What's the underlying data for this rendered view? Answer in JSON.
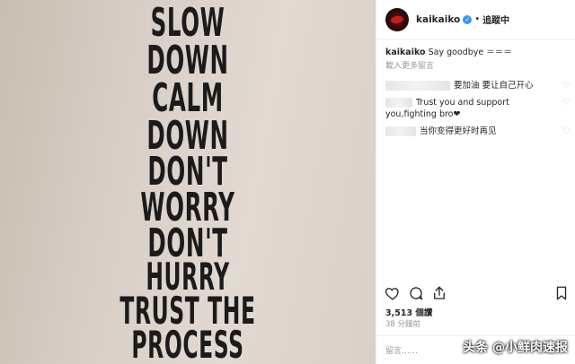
{
  "poster": {
    "lines": [
      "SLOW",
      "DOWN",
      "CALM",
      "DOWN",
      "DON'T",
      "WORRY",
      "DON'T",
      "HURRY",
      "TRUST THE",
      "PROCESS"
    ]
  },
  "header": {
    "username": "kaikaiko",
    "separator": "•",
    "follow_status": "追蹤中"
  },
  "caption": {
    "username": "kaikaiko",
    "text": "Say goodbye ＝＝＝"
  },
  "load_more": "載入更多留言",
  "comments": [
    {
      "text": "要加油 要让自己开心"
    },
    {
      "text": "Trust you and support you,fighting bro❤"
    },
    {
      "text": "当你变得更好时再见"
    }
  ],
  "likes": "3,513 個讚",
  "time": "38 分鐘前",
  "add_comment_placeholder": "留言……",
  "watermark": "头条 @小鲜肉速报",
  "icons": [
    "heart-icon",
    "comment-icon",
    "share-icon",
    "bookmark-icon"
  ]
}
